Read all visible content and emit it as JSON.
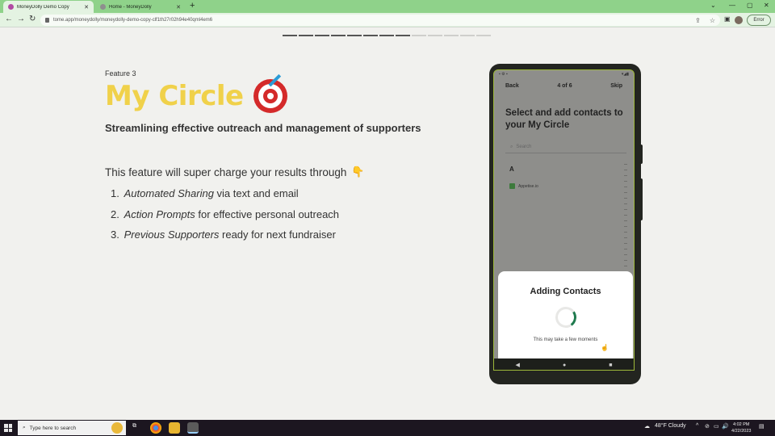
{
  "browser": {
    "tabs": [
      {
        "title": "MoneyDolly Demo Copy",
        "active": true
      },
      {
        "title": "Home - MoneyDolly",
        "active": false
      }
    ],
    "new_tab": "+",
    "url": "tome.app/moneydolly/moneydolly-demo-copy-clf1th27r02h94e40qml4em6",
    "error_button": "Error"
  },
  "slide": {
    "progress_total": 13,
    "progress_done": 8,
    "feature_label": "Feature 3",
    "title": "My Circle",
    "subtitle": "Streamlining effective outreach and management of supporters",
    "intro": "This feature will super charge your results through",
    "items": [
      {
        "num": "1.",
        "italic": "Automated Sharing",
        "rest": " via text and email"
      },
      {
        "num": "2.",
        "italic": "Action Prompts",
        "rest": " for effective personal outreach"
      },
      {
        "num": "3.",
        "italic": "Previous Supporters",
        "rest": " ready for next fundraiser"
      }
    ]
  },
  "phone": {
    "back": "Back",
    "step": "4 of 6",
    "skip": "Skip",
    "title": "Select and add contacts to your My Circle",
    "search_placeholder": "Search",
    "section_letter": "A",
    "contact": "Appetise.io",
    "modal_title": "Adding Contacts",
    "modal_sub": "This may take a few moments",
    "accent": "#1f7a4e"
  },
  "taskbar": {
    "search_placeholder": "Type here to search",
    "weather": "48°F Cloudy",
    "time": "4:02 PM",
    "date": "4/22/2023"
  }
}
